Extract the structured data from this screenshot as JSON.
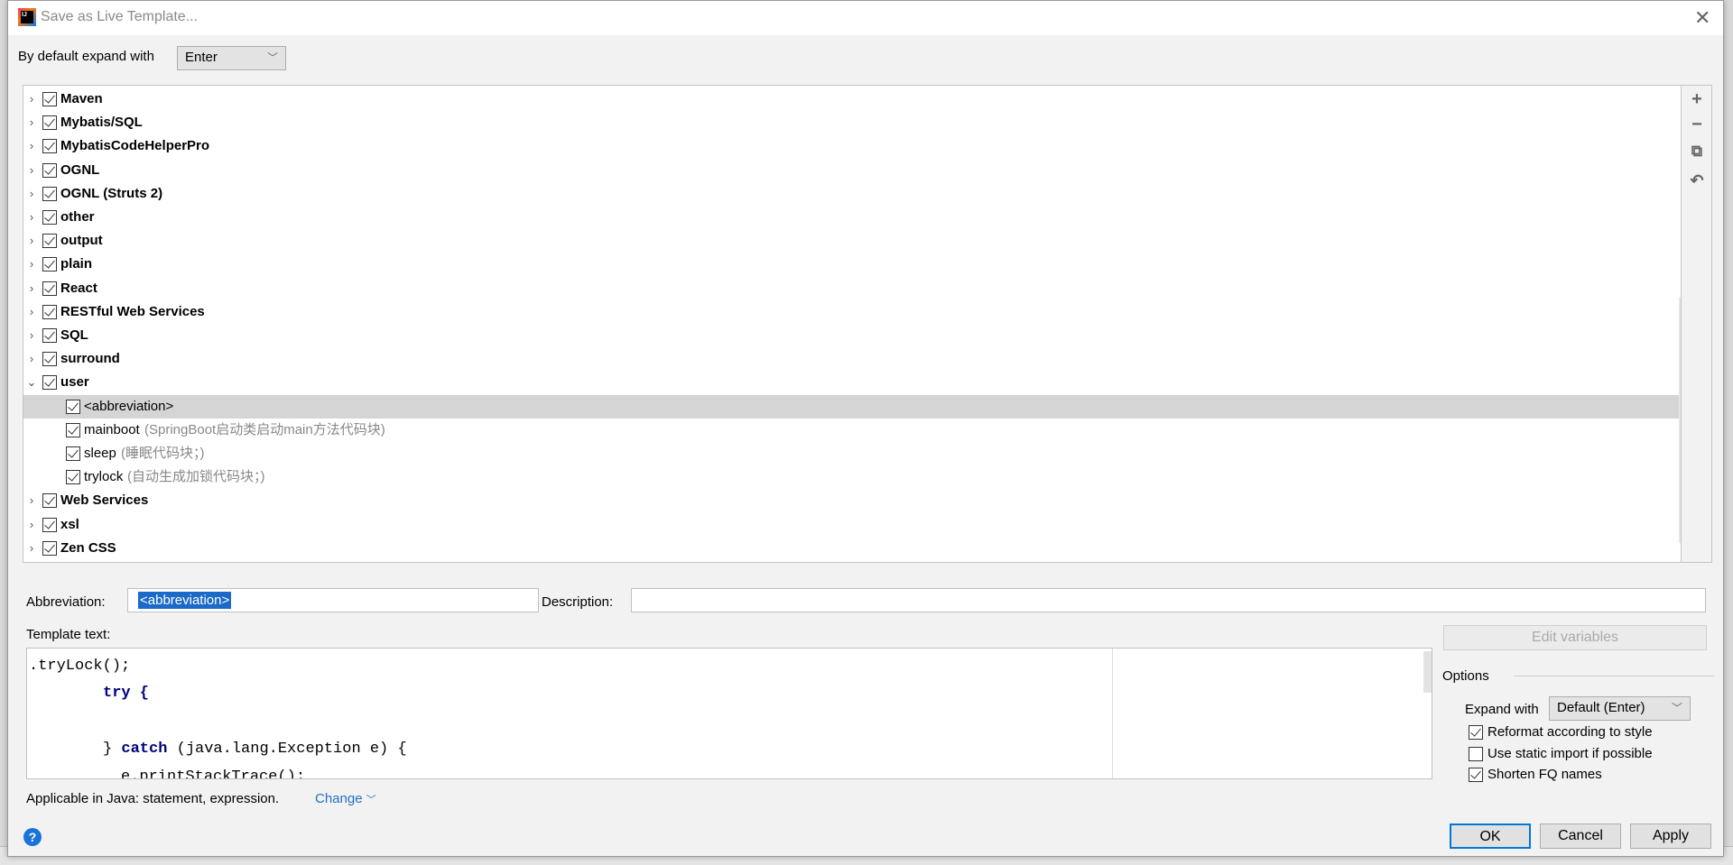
{
  "window": {
    "title": "Save as Live Template...",
    "logo": "IJ"
  },
  "expand_default": {
    "label": "By default expand with",
    "value": "Enter"
  },
  "tree": [
    {
      "label": "Maven",
      "group": true,
      "checked": true
    },
    {
      "label": "Mybatis/SQL",
      "group": true,
      "checked": true
    },
    {
      "label": "MybatisCodeHelperPro",
      "group": true,
      "checked": true
    },
    {
      "label": "OGNL",
      "group": true,
      "checked": true
    },
    {
      "label": "OGNL (Struts 2)",
      "group": true,
      "checked": true
    },
    {
      "label": "other",
      "group": true,
      "checked": true
    },
    {
      "label": "output",
      "group": true,
      "checked": true
    },
    {
      "label": "plain",
      "group": true,
      "checked": true
    },
    {
      "label": "React",
      "group": true,
      "checked": true
    },
    {
      "label": "RESTful Web Services",
      "group": true,
      "checked": true
    },
    {
      "label": "SQL",
      "group": true,
      "checked": true
    },
    {
      "label": "surround",
      "group": true,
      "checked": true
    },
    {
      "label": "user",
      "group": true,
      "checked": true,
      "expanded": true
    },
    {
      "label": "<abbreviation>",
      "group": false,
      "checked": true,
      "selected": true
    },
    {
      "label": "mainboot",
      "desc": "(SpringBoot启动类启动main方法代码块)",
      "group": false,
      "checked": true
    },
    {
      "label": "sleep",
      "desc": "(睡眠代码块；)",
      "group": false,
      "checked": true
    },
    {
      "label": "trylock",
      "desc": "(自动生成加锁代码块；)",
      "group": false,
      "checked": true
    },
    {
      "label": "Web Services",
      "group": true,
      "checked": true
    },
    {
      "label": "xsl",
      "group": true,
      "checked": true
    },
    {
      "label": "Zen CSS",
      "group": true,
      "checked": true
    }
  ],
  "toolbar": {
    "add": "+",
    "remove": "−",
    "copy": "⧉",
    "revert": "↶"
  },
  "abbreviation": {
    "label": "Abbreviation:",
    "value": "<abbreviation>"
  },
  "description": {
    "label": "Description:",
    "value": ""
  },
  "template_text": {
    "label": "Template text:",
    "lines": [
      ".tryLock();",
      "try {",
      "",
      "} catch (java.lang.Exception e) {",
      "e.printStackTrace();"
    ]
  },
  "applicable": {
    "text": "Applicable in Java: statement, expression.",
    "change": "Change"
  },
  "edit_variables": "Edit variables",
  "options": {
    "title": "Options",
    "expand_with_label": "Expand with",
    "expand_with_value": "Default (Enter)",
    "checkboxes": [
      {
        "label": "Reformat according to style",
        "checked": true
      },
      {
        "label": "Use static import if possible",
        "checked": false
      },
      {
        "label": "Shorten FQ names",
        "checked": true
      }
    ]
  },
  "buttons": {
    "ok": "OK",
    "cancel": "Cancel",
    "apply": "Apply"
  },
  "help": "?"
}
